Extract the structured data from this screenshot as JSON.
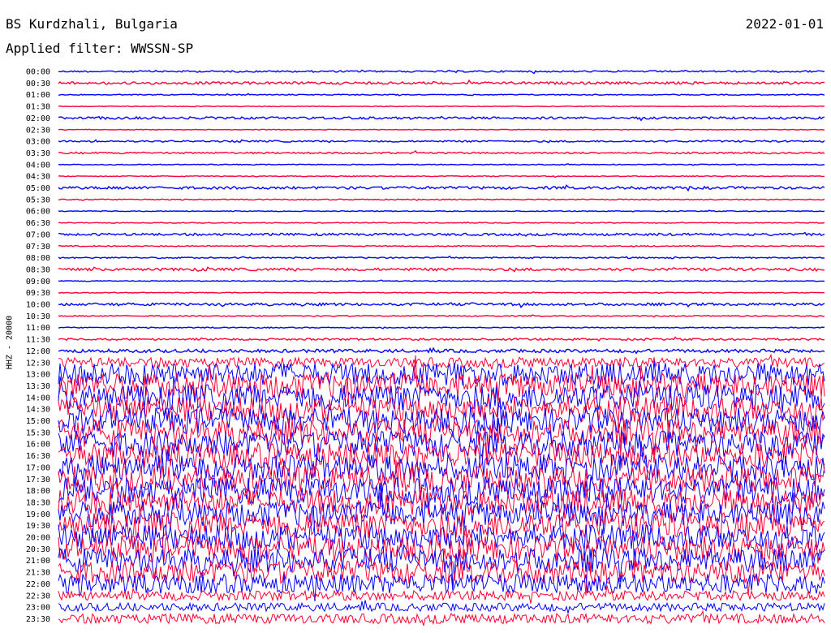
{
  "header": {
    "station": "BS Kurdzhali, Bulgaria",
    "date": "2022-01-01",
    "filter": "Applied filter: WWSSN-SP"
  },
  "colors": {
    "even_trace": "#0000ff",
    "odd_trace": "#ff0033"
  },
  "chart_data": {
    "type": "line",
    "title": "BS Kurdzhali, Bulgaria",
    "ylabel": "HHZ - 20000",
    "xlabel": "",
    "grid": false,
    "legend": "none",
    "rows": [
      {
        "label": "00:00",
        "amp": 1
      },
      {
        "label": "00:30",
        "amp": 1.5
      },
      {
        "label": "01:00",
        "amp": 0.6
      },
      {
        "label": "01:30",
        "amp": 0.4
      },
      {
        "label": "02:00",
        "amp": 1.4
      },
      {
        "label": "02:30",
        "amp": 0.4
      },
      {
        "label": "03:00",
        "amp": 1
      },
      {
        "label": "03:30",
        "amp": 1
      },
      {
        "label": "04:00",
        "amp": 0.5
      },
      {
        "label": "04:30",
        "amp": 0.5
      },
      {
        "label": "05:00",
        "amp": 1.6
      },
      {
        "label": "05:30",
        "amp": 0.6
      },
      {
        "label": "06:00",
        "amp": 0.5
      },
      {
        "label": "06:30",
        "amp": 0.5
      },
      {
        "label": "07:00",
        "amp": 1.4
      },
      {
        "label": "07:30",
        "amp": 0.6
      },
      {
        "label": "08:00",
        "amp": 0.8
      },
      {
        "label": "08:30",
        "amp": 1.6
      },
      {
        "label": "09:00",
        "amp": 0.5
      },
      {
        "label": "09:30",
        "amp": 0.5
      },
      {
        "label": "10:00",
        "amp": 1.6
      },
      {
        "label": "10:30",
        "amp": 0.6
      },
      {
        "label": "11:00",
        "amp": 0.6
      },
      {
        "label": "11:30",
        "amp": 1.2
      },
      {
        "label": "12:00",
        "amp": 2
      },
      {
        "label": "12:30",
        "amp": 6
      },
      {
        "label": "13:00",
        "amp": 14
      },
      {
        "label": "13:30",
        "amp": 16
      },
      {
        "label": "14:00",
        "amp": 16
      },
      {
        "label": "14:30",
        "amp": 16
      },
      {
        "label": "15:00",
        "amp": 16
      },
      {
        "label": "15:30",
        "amp": 16
      },
      {
        "label": "16:00",
        "amp": 16
      },
      {
        "label": "16:30",
        "amp": 16
      },
      {
        "label": "17:00",
        "amp": 16
      },
      {
        "label": "17:30",
        "amp": 16
      },
      {
        "label": "18:00",
        "amp": 16
      },
      {
        "label": "18:30",
        "amp": 16
      },
      {
        "label": "19:00",
        "amp": 16
      },
      {
        "label": "19:30",
        "amp": 16
      },
      {
        "label": "20:00",
        "amp": 16
      },
      {
        "label": "20:30",
        "amp": 16
      },
      {
        "label": "21:00",
        "amp": 15
      },
      {
        "label": "21:30",
        "amp": 14
      },
      {
        "label": "22:00",
        "amp": 12
      },
      {
        "label": "22:30",
        "amp": 6
      },
      {
        "label": "23:00",
        "amp": 5
      },
      {
        "label": "23:30",
        "amp": 6
      }
    ]
  }
}
